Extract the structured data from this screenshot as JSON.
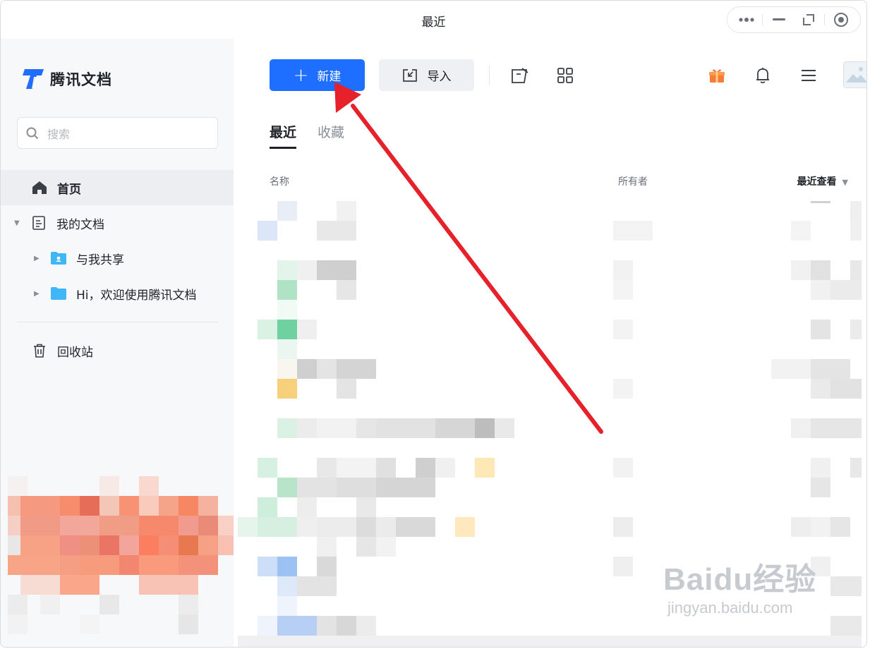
{
  "window": {
    "title": "最近"
  },
  "sidebar": {
    "app_name": "腾讯文档",
    "search_placeholder": "搜索",
    "items": [
      {
        "label": "首页"
      },
      {
        "label": "我的文档"
      },
      {
        "label": "与我共享"
      },
      {
        "label": "Hi，欢迎使用腾讯文档"
      },
      {
        "label": "回收站"
      }
    ]
  },
  "toolbar": {
    "new_label": "新建",
    "import_label": "导入"
  },
  "tabs": [
    {
      "label": "最近"
    },
    {
      "label": "收藏"
    }
  ],
  "columns": {
    "name": "名称",
    "owner": "所有者",
    "sort": "最近查看"
  },
  "watermark": {
    "brand": "Baidu经验",
    "url": "jingyan.baidu.com"
  },
  "colors": {
    "accent": "#1e6fff",
    "annotation": "#e62129",
    "sidebar_bg": "#f7f8fa"
  }
}
